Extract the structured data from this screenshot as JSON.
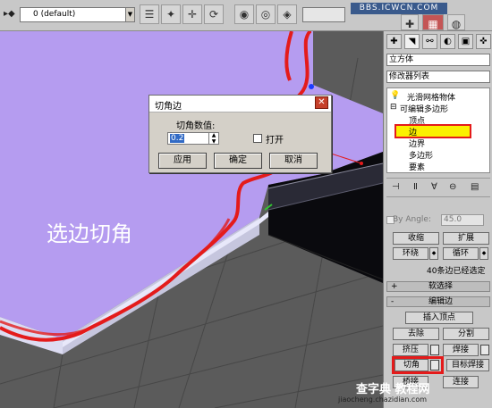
{
  "toolbar": {
    "layer_value": "0 (default)",
    "watermark": "BBS.ICWCN.COM"
  },
  "viewport": {
    "caption": "选边切角"
  },
  "dialog": {
    "title": "切角边",
    "label": "切角数值:",
    "value": "0.2",
    "checkbox_label": "打开",
    "checked": false,
    "buttons": {
      "apply": "应用",
      "ok": "确定",
      "cancel": "取消"
    }
  },
  "panel": {
    "object_name": "立方体",
    "modifier_list": "修改器列表",
    "stack": {
      "mesh_smooth": "光滑网格物体",
      "editable_poly": "可编辑多边形",
      "vertex": "顶点",
      "edge": "边",
      "border": "边界",
      "polygon": "多边形",
      "element": "要素"
    },
    "by_angle_label": "By Angle:",
    "by_angle_value": "45.0",
    "select_buttons": {
      "shrink": "收缩",
      "grow": "扩展",
      "ring": "环绕",
      "loop": "循环"
    },
    "status": "40条边已经选定",
    "rollouts": {
      "soft_selection": "软选择",
      "edit_edges": "编辑边"
    },
    "edit_buttons": {
      "insert_vertex": "插入顶点",
      "remove": "去除",
      "split": "分割",
      "extrude": "挤压",
      "weld": "焊接",
      "chamfer": "切角",
      "target_weld": "目标焊接",
      "bridge": "桥接",
      "connect": "连接"
    }
  },
  "footer_watermark": {
    "text": "查字典 教程网",
    "url": "jiaocheng.chazidian.com"
  },
  "colors": {
    "viewport_bg": "#5b5b5b",
    "face": "#b59cf0",
    "highlight_yellow": "#fbf000",
    "annotation_red": "#e41b1b"
  }
}
